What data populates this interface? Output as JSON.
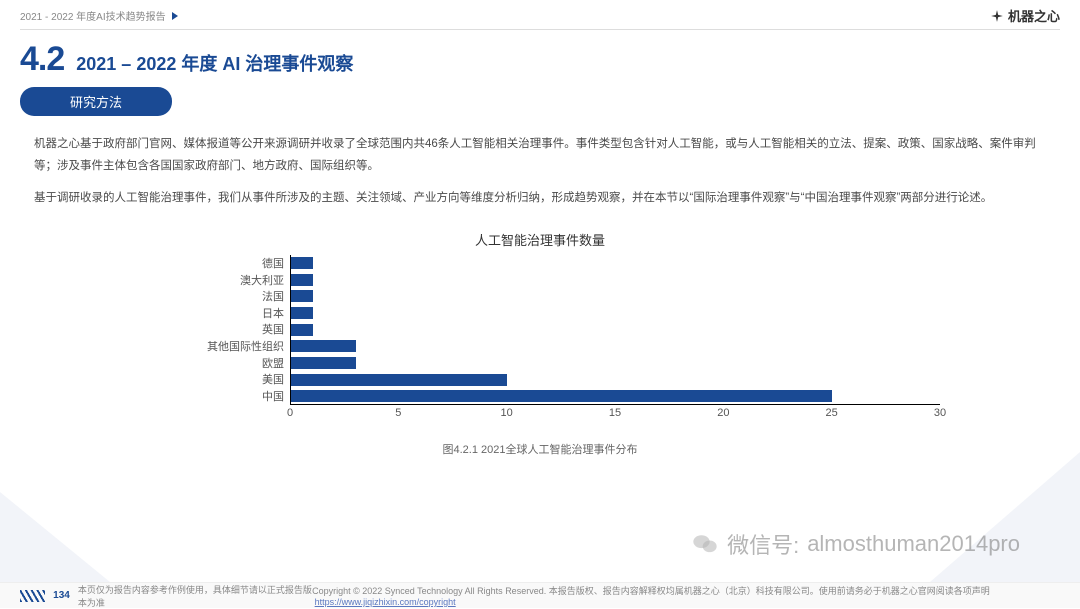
{
  "top": {
    "breadcrumb": "2021 - 2022 年度AI技术趋势报告",
    "brand": "机器之心"
  },
  "header": {
    "section_number": "4.2",
    "section_title": "2021 – 2022 年度 AI 治理事件观察"
  },
  "pill": {
    "label": "研究方法"
  },
  "body": {
    "p1": "机器之心基于政府部门官网、媒体报道等公开来源调研并收录了全球范围内共46条人工智能相关治理事件。事件类型包含针对人工智能，或与人工智能相关的立法、提案、政策、国家战略、案件审判等；涉及事件主体包含各国国家政府部门、地方政府、国际组织等。",
    "p2": "基于调研收录的人工智能治理事件，我们从事件所涉及的主题、关注领域、产业方向等维度分析归纳，形成趋势观察，并在本节以“国际治理事件观察”与“中国治理事件观察”两部分进行论述。"
  },
  "chart_data": {
    "type": "bar",
    "orientation": "horizontal",
    "title": "人工智能治理事件数量",
    "categories": [
      "德国",
      "澳大利亚",
      "法国",
      "日本",
      "英国",
      "其他国际性组织",
      "欧盟",
      "美国",
      "中国"
    ],
    "values": [
      1,
      1,
      1,
      1,
      1,
      3,
      3,
      10,
      25
    ],
    "xlabel": "",
    "ylabel": "",
    "xlim": [
      0,
      30
    ],
    "x_ticks": [
      0,
      5,
      10,
      15,
      20,
      25,
      30
    ],
    "caption": "图4.2.1 2021全球人工智能治理事件分布"
  },
  "watermark": {
    "prefix": "微信号:",
    "id": "almosthuman2014pro"
  },
  "footer": {
    "page": "134",
    "disclaimer_left": "本页仅为报告内容参考作例使用，具体细节请以正式报告版本为准",
    "copyright": "Copyright © 2022 Synced Technology  All Rights Reserved.  本报告版权、报告内容解释权均属机器之心（北京）科技有限公司。使用前请务必于机器之心官网阅读各项声明",
    "link_text": "https://www.jiqizhixin.com/copyright"
  }
}
